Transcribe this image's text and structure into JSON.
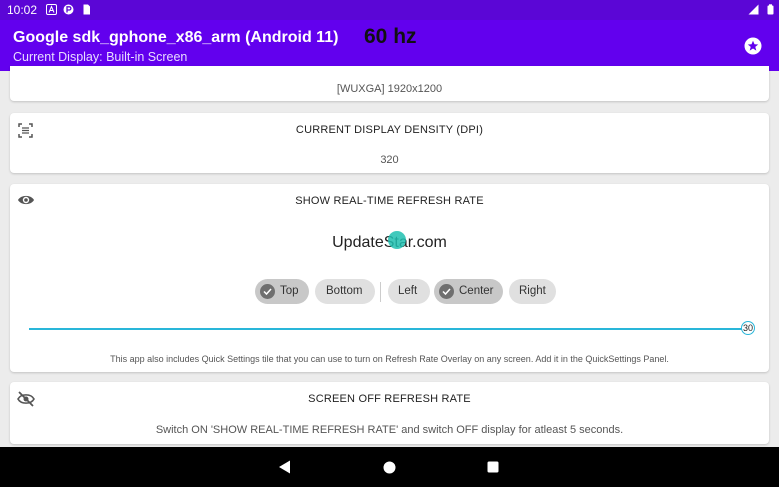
{
  "status_bar": {
    "time": "10:02"
  },
  "app_bar": {
    "title": "Google sdk_gphone_x86_arm (Android 11)",
    "refresh_overlay": "60 hz",
    "subtitle": "Current Display: Built-in Screen"
  },
  "resolution_card": {
    "value": "[WUXGA] 1920x1200"
  },
  "density_card": {
    "label": "CURRENT DISPLAY DENSITY (DPI)",
    "value": "320"
  },
  "realtime_card": {
    "label": "SHOW REAL-TIME REFRESH RATE",
    "watermark": "UpdateStar.com",
    "position_chips": [
      {
        "label": "Top",
        "selected": true
      },
      {
        "label": "Bottom",
        "selected": false
      },
      {
        "label": "Left",
        "selected": false
      },
      {
        "label": "Center",
        "selected": true
      },
      {
        "label": "Right",
        "selected": false
      }
    ],
    "slider_value": "30",
    "slider_fraction": 1.0,
    "note": "This app also includes Quick Settings tile that you can use to turn on Refresh Rate Overlay on any screen. Add it in the QuickSettings Panel."
  },
  "screen_off_card": {
    "label": "SCREEN OFF REFRESH RATE",
    "description": "Switch ON 'SHOW REAL-TIME REFRESH RATE' and switch OFF display for atleast 5 seconds."
  },
  "colors": {
    "status_bar": "#5b06d6",
    "app_bar": "#6200ee",
    "slider": "#29b6d9"
  },
  "icons": [
    "sim-icon",
    "alert-icon",
    "battery-icon",
    "star-icon",
    "density-icon",
    "eye-icon",
    "eye-off-icon",
    "back-icon",
    "home-icon",
    "recents-icon"
  ]
}
